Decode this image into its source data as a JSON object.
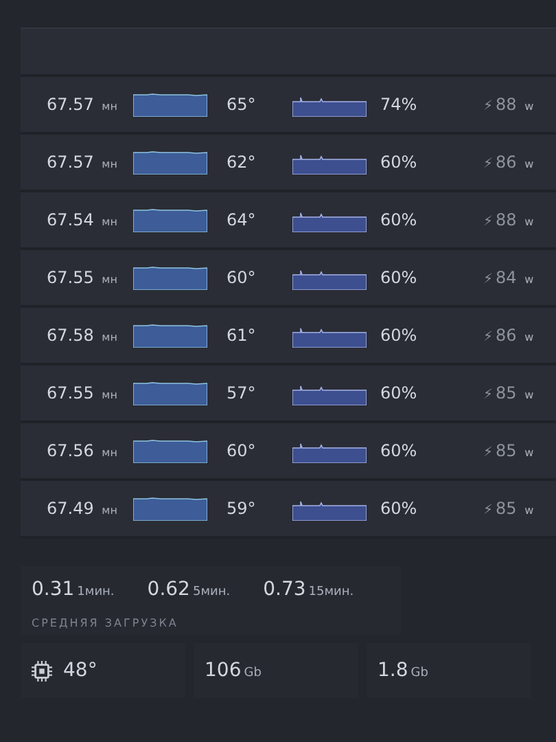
{
  "gpus": [
    {
      "hashrate": "67.57",
      "hashrate_unit": "мн",
      "temp": "65°",
      "fan": "74%",
      "power_icon": "⚡",
      "power": "88",
      "power_unit": "w"
    },
    {
      "hashrate": "67.57",
      "hashrate_unit": "мн",
      "temp": "62°",
      "fan": "60%",
      "power_icon": "⚡",
      "power": "86",
      "power_unit": "w"
    },
    {
      "hashrate": "67.54",
      "hashrate_unit": "мн",
      "temp": "64°",
      "fan": "60%",
      "power_icon": "⚡",
      "power": "88",
      "power_unit": "w"
    },
    {
      "hashrate": "67.55",
      "hashrate_unit": "мн",
      "temp": "60°",
      "fan": "60%",
      "power_icon": "⚡",
      "power": "84",
      "power_unit": "w"
    },
    {
      "hashrate": "67.58",
      "hashrate_unit": "мн",
      "temp": "61°",
      "fan": "60%",
      "power_icon": "⚡",
      "power": "86",
      "power_unit": "w"
    },
    {
      "hashrate": "67.55",
      "hashrate_unit": "мн",
      "temp": "57°",
      "fan": "60%",
      "power_icon": "⚡",
      "power": "85",
      "power_unit": "w"
    },
    {
      "hashrate": "67.56",
      "hashrate_unit": "мн",
      "temp": "60°",
      "fan": "60%",
      "power_icon": "⚡",
      "power": "85",
      "power_unit": "w"
    },
    {
      "hashrate": "67.49",
      "hashrate_unit": "мн",
      "temp": "59°",
      "fan": "60%",
      "power_icon": "⚡",
      "power": "85",
      "power_unit": "w"
    }
  ],
  "load_average": {
    "values": [
      {
        "value": "0.31",
        "unit": "1мин."
      },
      {
        "value": "0.62",
        "unit": "5мин."
      },
      {
        "value": "0.73",
        "unit": "15мин."
      }
    ],
    "label": "СРЕДНЯЯ ЗАГРУЗКА"
  },
  "stats": [
    {
      "kind": "cpu",
      "value": "48°"
    },
    {
      "kind": "plain",
      "value": "106",
      "unit": "Gb"
    },
    {
      "kind": "plain",
      "value": "1.8",
      "unit": "Gb"
    }
  ]
}
